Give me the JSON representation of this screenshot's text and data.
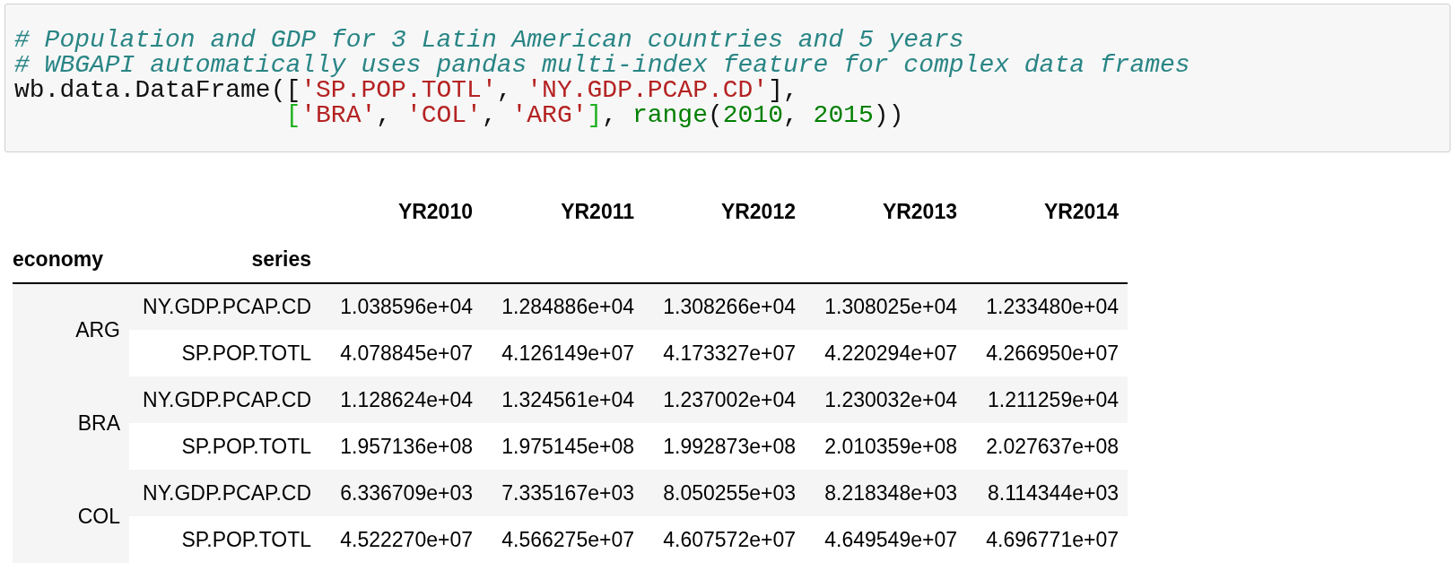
{
  "code_cell": {
    "lines": [
      [
        {
          "kind": "comment",
          "text": "# Population and GDP for 3 Latin American countries and 5 years"
        }
      ],
      [
        {
          "kind": "comment",
          "text": "# WBGAPI automatically uses pandas multi-index feature for complex data frames"
        }
      ],
      [
        {
          "kind": "plain",
          "text": "wb.data.DataFrame(["
        },
        {
          "kind": "string",
          "text": "'SP.POP.TOTL'"
        },
        {
          "kind": "plain",
          "text": ", "
        },
        {
          "kind": "string",
          "text": "'NY.GDP.PCAP.CD'"
        },
        {
          "kind": "plain",
          "text": "],"
        }
      ],
      [
        {
          "kind": "matched",
          "text": "                  ["
        },
        {
          "kind": "string",
          "text": "'BRA'"
        },
        {
          "kind": "plain",
          "text": ", "
        },
        {
          "kind": "string",
          "text": "'COL'"
        },
        {
          "kind": "plain",
          "text": ", "
        },
        {
          "kind": "string",
          "text": "'ARG'"
        },
        {
          "kind": "matched",
          "text": "]"
        },
        {
          "kind": "plain",
          "text": ", "
        },
        {
          "kind": "builtin",
          "text": "range"
        },
        {
          "kind": "plain",
          "text": "("
        },
        {
          "kind": "number",
          "text": "2010"
        },
        {
          "kind": "plain",
          "text": ", "
        },
        {
          "kind": "number",
          "text": "2015"
        },
        {
          "kind": "plain",
          "text": "))"
        }
      ]
    ]
  },
  "table": {
    "columns": [
      "YR2010",
      "YR2011",
      "YR2012",
      "YR2013",
      "YR2014"
    ],
    "index_names": [
      "economy",
      "series"
    ],
    "groups": [
      {
        "economy": "ARG",
        "rows": [
          {
            "series": "NY.GDP.PCAP.CD",
            "values": [
              "1.038596e+04",
              "1.284886e+04",
              "1.308266e+04",
              "1.308025e+04",
              "1.233480e+04"
            ]
          },
          {
            "series": "SP.POP.TOTL",
            "values": [
              "4.078845e+07",
              "4.126149e+07",
              "4.173327e+07",
              "4.220294e+07",
              "4.266950e+07"
            ]
          }
        ]
      },
      {
        "economy": "BRA",
        "rows": [
          {
            "series": "NY.GDP.PCAP.CD",
            "values": [
              "1.128624e+04",
              "1.324561e+04",
              "1.237002e+04",
              "1.230032e+04",
              "1.211259e+04"
            ]
          },
          {
            "series": "SP.POP.TOTL",
            "values": [
              "1.957136e+08",
              "1.975145e+08",
              "1.992873e+08",
              "2.010359e+08",
              "2.027637e+08"
            ]
          }
        ]
      },
      {
        "economy": "COL",
        "rows": [
          {
            "series": "NY.GDP.PCAP.CD",
            "values": [
              "6.336709e+03",
              "7.335167e+03",
              "8.050255e+03",
              "8.218348e+03",
              "8.114344e+03"
            ]
          },
          {
            "series": "SP.POP.TOTL",
            "values": [
              "4.522270e+07",
              "4.566275e+07",
              "4.607572e+07",
              "4.649549e+07",
              "4.696771e+07"
            ]
          }
        ]
      }
    ]
  }
}
